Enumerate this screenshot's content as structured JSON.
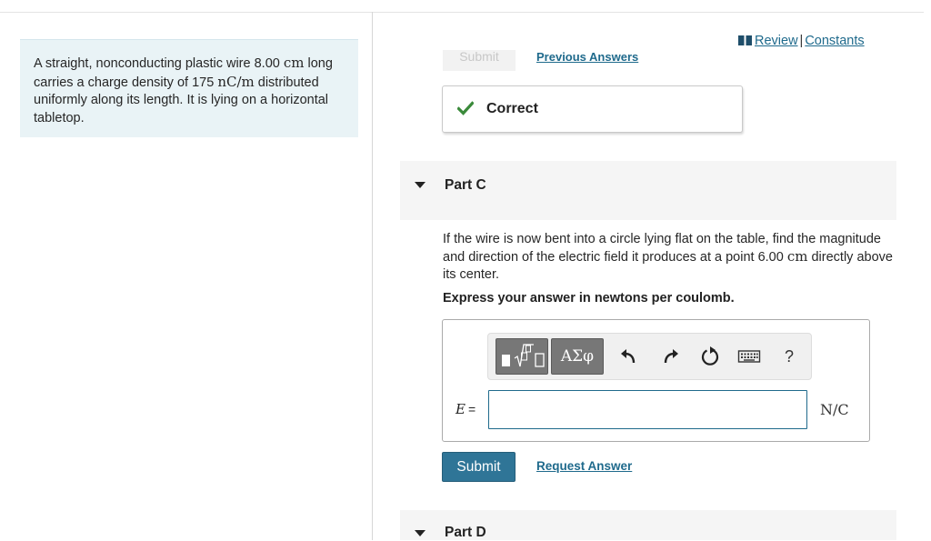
{
  "problem": {
    "text_1": "A straight, nonconducting plastic wire 8.00 ",
    "unit_cm": "cm",
    "text_2": " long carries a charge density of 175 ",
    "unit_density": "nC/m",
    "text_3": " distributed uniformly along its length. It is lying on a horizontal tabletop."
  },
  "header_links": {
    "review": "Review",
    "separator": "|",
    "constants": "Constants"
  },
  "previous_part": {
    "submit_label": "Submit",
    "previous_answers": "Previous Answers",
    "feedback": "Correct"
  },
  "part_c": {
    "title": "Part C",
    "question_1": "If the wire is now bent into a circle lying flat on the table, find the magnitude and direction of the electric field it produces at a point 6.00 ",
    "question_unit": "cm",
    "question_2": " directly above its center.",
    "instruction": "Express your answer in newtons per coulomb.",
    "toolbar": {
      "greek_label": "ΑΣφ",
      "help_label": "?"
    },
    "variable": "E",
    "equals": "=",
    "input_value": "",
    "unit": "N/C",
    "submit_label": "Submit",
    "request_answer": "Request Answer"
  },
  "part_d": {
    "title": "Part D"
  },
  "colors": {
    "accent": "#2f7597",
    "link": "#1f6a8c",
    "problem_bg": "#e9f3f6",
    "success": "#3a8a3a"
  }
}
